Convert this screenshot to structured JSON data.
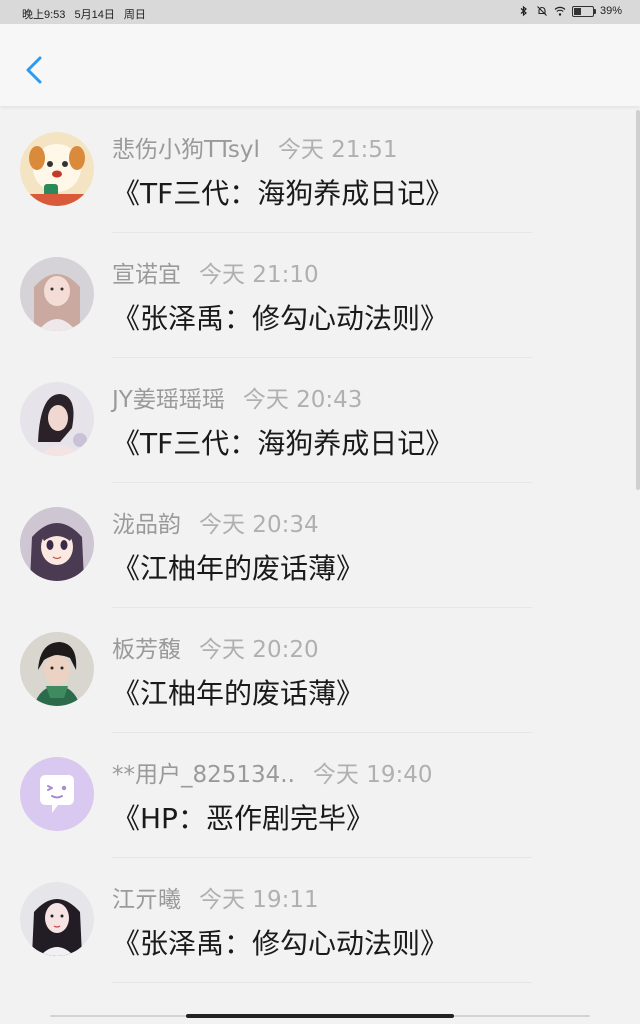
{
  "status_bar": {
    "time": "晚上9:53",
    "date": "5月14日",
    "weekday": "周日",
    "battery": "39%",
    "battery_level": 0.39
  },
  "header": {
    "back_icon": "chevron-left-icon",
    "accent": "#2b9af3"
  },
  "items": [
    {
      "user": "悲伤小狗TTsyl",
      "time": "今天 21:51",
      "title": "《TF三代：海狗养成日记》"
    },
    {
      "user": "宣诺宜",
      "time": "今天 21:10",
      "title": "《张泽禹：修勾心动法则》"
    },
    {
      "user": "JY姜瑶瑶瑶",
      "time": "今天 20:43",
      "title": "《TF三代：海狗养成日记》"
    },
    {
      "user": "泷品韵",
      "time": "今天 20:34",
      "title": "《江柚年的废话薄》"
    },
    {
      "user": "板芳馥",
      "time": "今天 20:20",
      "title": "《江柚年的废话薄》"
    },
    {
      "user": "**用户_825134..",
      "time": "今天 19:40",
      "title": "《HP：恶作剧完毕》"
    },
    {
      "user": "江亓曦",
      "time": "今天 19:11",
      "title": "《张泽禹：修勾心动法则》"
    }
  ]
}
